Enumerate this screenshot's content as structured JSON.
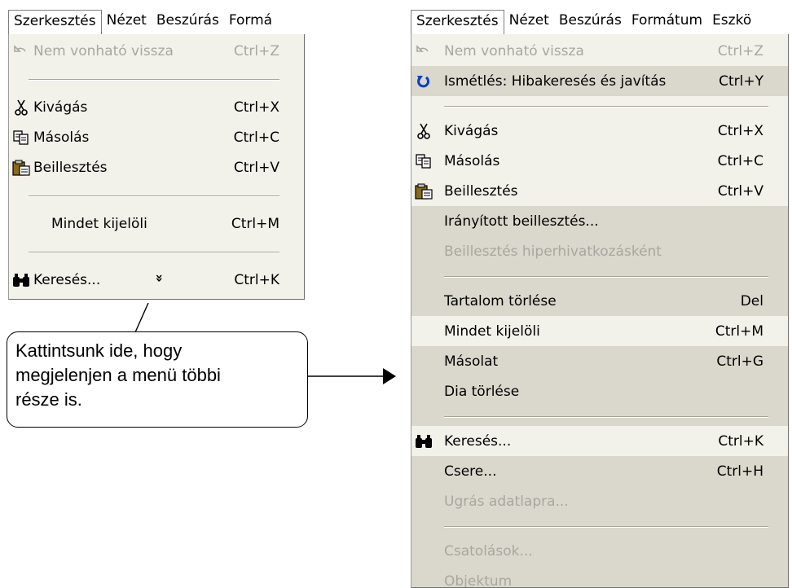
{
  "left_menubar": [
    "Szerkesztés",
    "Nézet",
    "Beszúrás",
    "Formá"
  ],
  "right_menubar": [
    "Szerkesztés",
    "Nézet",
    "Beszúrás",
    "Formátum",
    "Eszkö"
  ],
  "left_menu": [
    {
      "type": "item",
      "icon": "undo-icon",
      "label": "Nem vonható vissza",
      "shortcut": "Ctrl+Z",
      "disabled": true
    },
    {
      "type": "sep"
    },
    {
      "type": "item",
      "icon": "scissors-icon",
      "label": "Kivágás",
      "shortcut": "Ctrl+X"
    },
    {
      "type": "item",
      "icon": "copy-icon",
      "label": "Másolás",
      "shortcut": "Ctrl+C"
    },
    {
      "type": "item",
      "icon": "paste-icon",
      "label": "Beillesztés",
      "shortcut": "Ctrl+V"
    },
    {
      "type": "sep"
    },
    {
      "type": "item",
      "label": "Mindet kijelöli",
      "shortcut": "Ctrl+M"
    },
    {
      "type": "sep"
    },
    {
      "type": "item",
      "icon": "binoculars-icon",
      "label": "Keresés...",
      "shortcut": "Ctrl+K"
    }
  ],
  "expand_glyph": "»",
  "callout_lines": [
    "Kattintsunk ide, hogy",
    "megjelenjen a menü többi",
    "része is."
  ],
  "right_menu": [
    {
      "type": "item",
      "icon": "undo-icon",
      "label": "Nem vonható vissza",
      "shortcut": "Ctrl+Z",
      "disabled": true
    },
    {
      "type": "item",
      "icon": "redo-icon",
      "label": "Ismétlés: Hibakeresés és javítás",
      "shortcut": "Ctrl+Y",
      "highlight": true
    },
    {
      "type": "sep"
    },
    {
      "type": "item",
      "icon": "scissors-icon",
      "label": "Kivágás",
      "shortcut": "Ctrl+X"
    },
    {
      "type": "item",
      "icon": "copy-icon",
      "label": "Másolás",
      "shortcut": "Ctrl+C"
    },
    {
      "type": "item",
      "icon": "paste-icon",
      "label": "Beillesztés",
      "shortcut": "Ctrl+V"
    },
    {
      "type": "item",
      "label": "Irányított beillesztés...",
      "rare": true
    },
    {
      "type": "item",
      "label": "Beillesztés hiperhivatkozásként",
      "disabled": true,
      "rare": true
    },
    {
      "type": "sep",
      "rare": true
    },
    {
      "type": "item",
      "label": "Tartalom törlése",
      "shortcut": "Del",
      "rare": true
    },
    {
      "type": "item",
      "label": "Mindet kijelöli",
      "shortcut": "Ctrl+M"
    },
    {
      "type": "item",
      "label": "Másolat",
      "shortcut": "Ctrl+G",
      "rare": true
    },
    {
      "type": "item",
      "label": "Dia törlése",
      "rare": true
    },
    {
      "type": "sep",
      "rare": true
    },
    {
      "type": "item",
      "icon": "binoculars-icon",
      "label": "Keresés...",
      "shortcut": "Ctrl+K"
    },
    {
      "type": "item",
      "label": "Csere...",
      "shortcut": "Ctrl+H",
      "rare": true
    },
    {
      "type": "item",
      "label": "Ugrás adatlapra...",
      "disabled": true,
      "rare": true
    },
    {
      "type": "sep",
      "rare": true
    },
    {
      "type": "item",
      "label": "Csatolások...",
      "disabled": true,
      "rare": true
    },
    {
      "type": "item",
      "label": "Objektum",
      "disabled": true,
      "rare": true
    }
  ]
}
